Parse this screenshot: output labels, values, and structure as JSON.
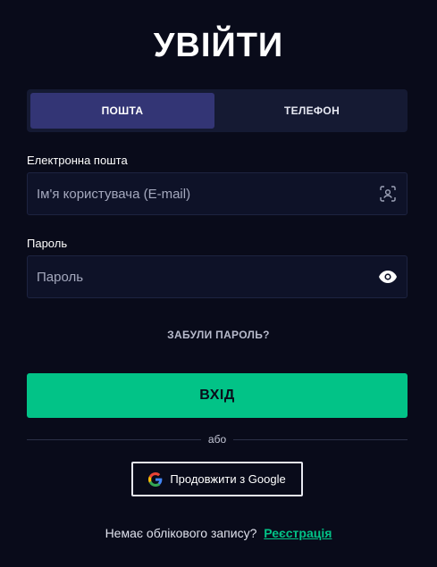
{
  "page": {
    "title": "УВІЙТИ"
  },
  "tabs": [
    {
      "label": "ПОШТА",
      "active": true
    },
    {
      "label": "ТЕЛЕФОН",
      "active": false
    }
  ],
  "email": {
    "label": "Електронна пошта",
    "value": "",
    "placeholder": "Ім'я користувача (E-mail)",
    "icon": "user-scan-icon"
  },
  "password": {
    "label": "Пароль",
    "value": "",
    "placeholder": "Пароль",
    "icon": "eye-icon"
  },
  "forgot_label": "ЗАБУЛИ ПАРОЛЬ?",
  "login_label": "ВХІД",
  "divider_text": "або",
  "google": {
    "label": "Продовжити з Google",
    "icon": "google-icon"
  },
  "signup": {
    "prompt": "Немає облікового запису?",
    "link": "Реєстрація"
  },
  "colors": {
    "background": "#090b1a",
    "tab_active": "#333575",
    "tabs_bg": "#151a33",
    "accent": "#02c387",
    "field_bg": "#0e1228"
  }
}
